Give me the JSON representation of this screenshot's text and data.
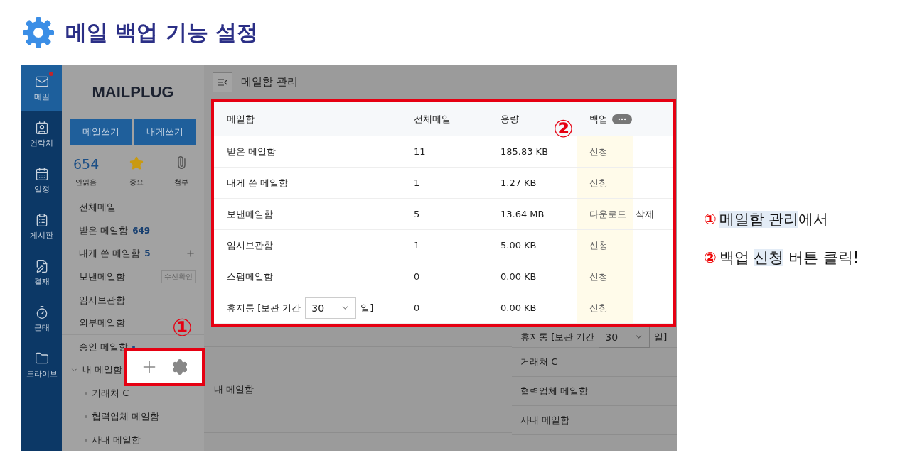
{
  "title": "메일 백업 기능 설정",
  "nav": [
    {
      "label": "메일",
      "selected": true,
      "alert": true
    },
    {
      "label": "연락처",
      "selected": false,
      "alert": false
    },
    {
      "label": "일정",
      "selected": false,
      "alert": false
    },
    {
      "label": "게시판",
      "selected": false,
      "alert": false
    },
    {
      "label": "결재",
      "selected": false,
      "alert": false
    },
    {
      "label": "근태",
      "selected": false,
      "alert": false
    },
    {
      "label": "드라이브",
      "selected": false,
      "alert": false
    }
  ],
  "sidebar": {
    "logo": "MAILPLUG",
    "buttons": [
      "메일쓰기",
      "내게쓰기"
    ],
    "stats": [
      {
        "kind": "count",
        "value": "654",
        "label": "안읽음"
      },
      {
        "kind": "star",
        "label": "중요"
      },
      {
        "kind": "clip",
        "label": "첨부"
      }
    ],
    "items": [
      {
        "label": "전체메일"
      },
      {
        "label": "받은 메일함",
        "count": "649"
      },
      {
        "label": "내게 쓴 메일함",
        "count": "5",
        "add": true
      },
      {
        "label": "보낸메일함",
        "badge": "수신확인"
      },
      {
        "label": "임시보관함"
      },
      {
        "label": "외부메일함",
        "divider": true
      },
      {
        "label": "승인 메일함",
        "dot": true
      },
      {
        "label": "내 메일함",
        "expanded": true,
        "children": [
          {
            "label": "거래처 C"
          },
          {
            "label": "협력업체 메일함"
          },
          {
            "label": "사내 메일함"
          }
        ]
      }
    ]
  },
  "main": {
    "title": "메일함 관리",
    "table": {
      "columns": [
        "메일함",
        "전체메일",
        "용량",
        "백업"
      ],
      "rows": [
        {
          "name": "받은 메일함",
          "total": "11",
          "size": "185.83 KB",
          "backup": {
            "kind": "apply",
            "label": "신청"
          }
        },
        {
          "name": "내게 쓴 메일함",
          "total": "1",
          "size": "1.27 KB",
          "backup": {
            "kind": "apply",
            "label": "신청"
          }
        },
        {
          "name": "보낸메일함",
          "total": "5",
          "size": "13.64 MB",
          "backup": {
            "kind": "download",
            "label": "다운로드",
            "delete": "삭제"
          }
        },
        {
          "name": "임시보관함",
          "total": "1",
          "size": "5.00 KB",
          "backup": {
            "kind": "apply",
            "label": "신청"
          }
        },
        {
          "name": "스팸메일함",
          "total": "0",
          "size": "0.00 KB",
          "backup": {
            "kind": "apply",
            "label": "신청"
          }
        },
        {
          "name": "휴지통 [보관 기간",
          "select": "30",
          "suffix": "일]",
          "total": "0",
          "size": "0.00 KB",
          "backup": {
            "kind": "apply",
            "label": "신청"
          }
        }
      ]
    },
    "behind": {
      "trash": {
        "name": "휴지통 [보관 기간",
        "select": "30",
        "suffix": "일]"
      },
      "group": "내 메일함",
      "folders": [
        "거래처 C",
        "협력업체 메일함",
        "사내 메일함"
      ]
    }
  },
  "markers": [
    "①",
    "②"
  ],
  "notes": [
    {
      "marker": "①",
      "parts": [
        {
          "text": "메일함 관리",
          "highlight": true
        },
        {
          "text": "에서",
          "highlight": false
        }
      ]
    },
    {
      "marker": "②",
      "parts": [
        {
          "text": "백업 ",
          "highlight": false
        },
        {
          "text": "신청",
          "highlight": true
        },
        {
          "text": " 버튼 클릭!",
          "highlight": false
        }
      ]
    }
  ]
}
